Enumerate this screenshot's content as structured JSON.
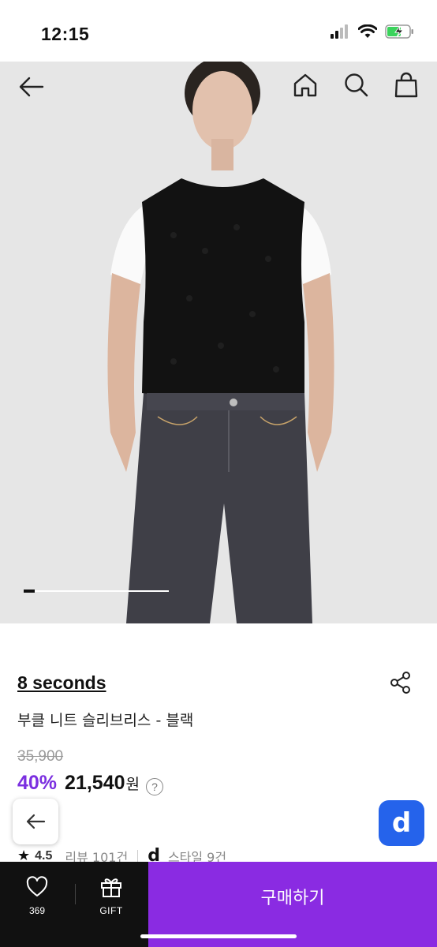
{
  "status_bar": {
    "time": "12:15"
  },
  "header": {
    "icons": [
      "back-arrow-icon",
      "home-icon",
      "search-icon",
      "shopping-bag-icon"
    ]
  },
  "carousel": {
    "current": 1
  },
  "product": {
    "brand": "8 seconds",
    "name": "부클 니트 슬리브리스 - 블랙",
    "original_price": "35,900",
    "discount": "40%",
    "sale_price": "21,540",
    "currency": "원",
    "help": "?"
  },
  "meta": {
    "rating": "4.5",
    "reviews": "리뷰 101건",
    "style_logo": "d",
    "styles": "스타일 9건"
  },
  "floating": {
    "app_logo": "d"
  },
  "bottom_bar": {
    "like_count": "369",
    "gift_label": "GIFT",
    "buy_label": "구매하기"
  },
  "colors": {
    "accent": "#8a2be2",
    "discount": "#7b2fe0",
    "app": "#2563eb",
    "bar": "#111111"
  }
}
